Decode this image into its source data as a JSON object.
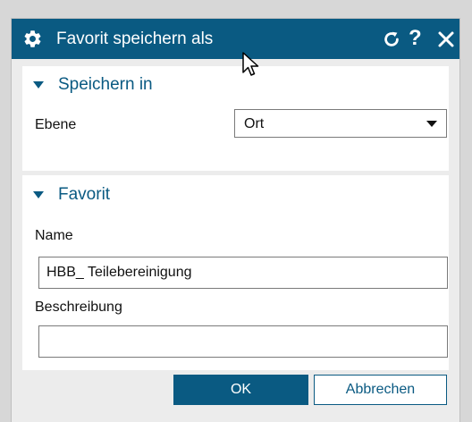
{
  "window": {
    "title": "Favorit speichern als",
    "icons": {
      "title": "gear-icon",
      "reset": "refresh-icon",
      "help": "?",
      "close": "close-icon"
    },
    "accent_color": "#0a5a82"
  },
  "section_save_in": {
    "label": "Speichern in",
    "field_label": "Ebene",
    "dropdown_value": "Ort"
  },
  "section_favorite": {
    "label": "Favorit",
    "name_label": "Name",
    "name_value": "HBB_ Teilebereinigung",
    "description_label": "Beschreibung",
    "description_value": ""
  },
  "buttons": {
    "ok": "OK",
    "cancel": "Abbrechen"
  }
}
